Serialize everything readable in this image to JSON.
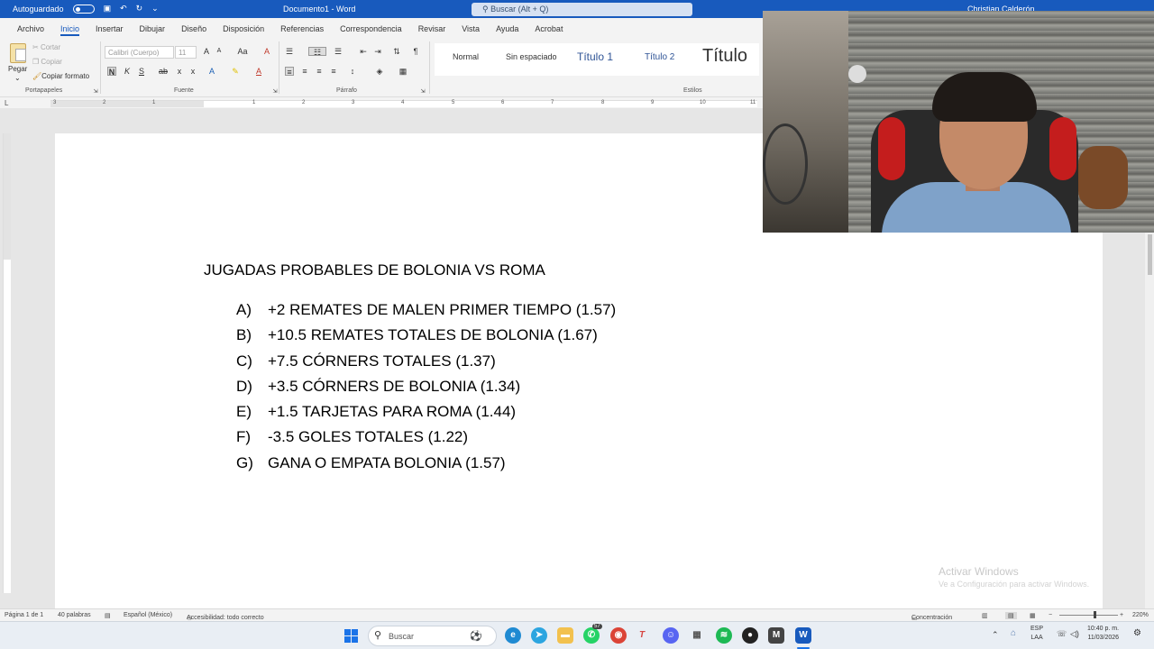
{
  "window": {
    "autosave_label": "Autoguardado",
    "document_title": "Documento1 - Word",
    "search_placeholder": "Buscar (Alt + Q)",
    "user_name": "Christian Calderón"
  },
  "ribbon_tabs": [
    {
      "label": "Archivo"
    },
    {
      "label": "Inicio",
      "active": true
    },
    {
      "label": "Insertar"
    },
    {
      "label": "Dibujar"
    },
    {
      "label": "Diseño"
    },
    {
      "label": "Disposición"
    },
    {
      "label": "Referencias"
    },
    {
      "label": "Correspondencia"
    },
    {
      "label": "Revisar"
    },
    {
      "label": "Vista"
    },
    {
      "label": "Ayuda"
    },
    {
      "label": "Acrobat"
    }
  ],
  "clipboard": {
    "paste": "Pegar",
    "cut": "Cortar",
    "copy": "Copiar",
    "format_painter": "Copiar formato",
    "group": "Portapapeles"
  },
  "font": {
    "name": "Calibri (Cuerpo)",
    "size": "11",
    "group": "Fuente"
  },
  "paragraph": {
    "group": "Párrafo"
  },
  "styles": {
    "group": "Estilos",
    "items": [
      "Normal",
      "Sin espaciado",
      "Título 1",
      "Título 2",
      "Título"
    ]
  },
  "ruler_numbers": [
    "3",
    "2",
    "1",
    "1",
    "2",
    "3",
    "4",
    "5",
    "6",
    "7",
    "8",
    "9",
    "10",
    "11"
  ],
  "document": {
    "title": "JUGADAS PROBABLES DE BOLONIA VS ROMA",
    "items": [
      {
        "letter": "A)",
        "text": "+2 REMATES DE MALEN PRIMER TIEMPO (1.57)"
      },
      {
        "letter": "B)",
        "text": "+10.5 REMATES TOTALES DE BOLONIA (1.67)"
      },
      {
        "letter": "C)",
        "text": "+7.5 CÓRNERS TOTALES (1.37)"
      },
      {
        "letter": "D)",
        "text": "+3.5 CÓRNERS DE BOLONIA (1.34)"
      },
      {
        "letter": "E)",
        "text": "+1.5 TARJETAS PARA ROMA (1.44)"
      },
      {
        "letter": "F)",
        "text": "-3.5 GOLES TOTALES (1.22)"
      },
      {
        "letter": "G)",
        "text": "GANA O EMPATA BOLONIA (1.57)"
      }
    ]
  },
  "watermark": {
    "line1": "Activar Windows",
    "line2": "Ve a Configuración para activar Windows."
  },
  "statusbar": {
    "page": "Página 1 de 1",
    "words": "40 palabras",
    "language": "Español (México)",
    "accessibility": "Accesibilidad: todo correcto",
    "focus": "Concentración",
    "zoom": "220%"
  },
  "taskbar": {
    "search_placeholder": "Buscar",
    "whatsapp_badge": "57",
    "lang_line1": "ESP",
    "lang_line2": "LAA",
    "time": "10:40 p. m.",
    "date": "11/03/2026"
  },
  "colors": {
    "word_blue": "#185abd",
    "ribbon_bg": "#f3f3f3",
    "doc_bg": "#e6e6e6"
  }
}
